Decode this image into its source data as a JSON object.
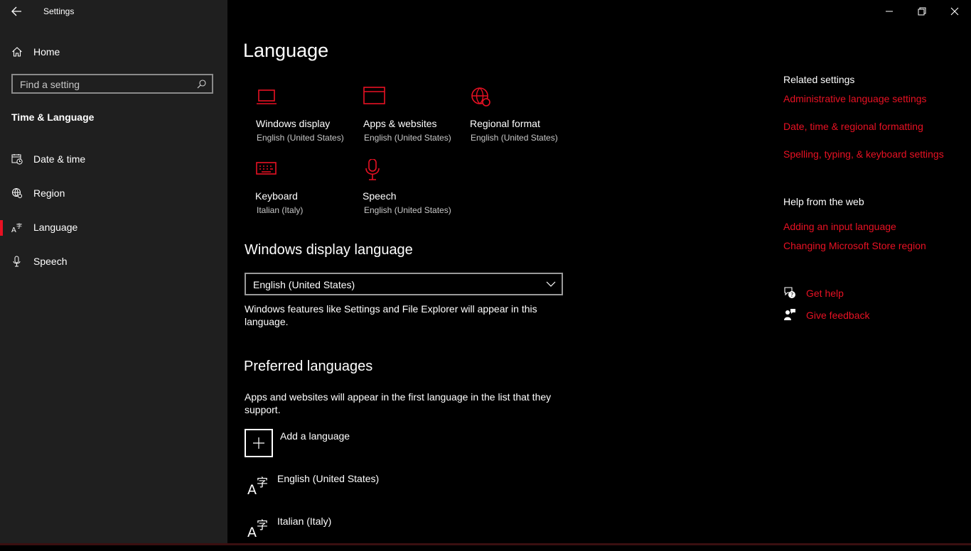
{
  "window": {
    "title": "Settings"
  },
  "sidebar": {
    "home_label": "Home",
    "search_placeholder": "Find a setting",
    "section_title": "Time & Language",
    "items": [
      {
        "label": "Date & time",
        "icon": "calendar-clock-icon"
      },
      {
        "label": "Region",
        "icon": "globe-icon"
      },
      {
        "label": "Language",
        "icon": "language-icon",
        "active": true
      },
      {
        "label": "Speech",
        "icon": "microphone-icon"
      }
    ]
  },
  "main": {
    "title": "Language",
    "tiles": [
      {
        "label": "Windows display",
        "value": "English (United States)",
        "icon": "laptop-icon"
      },
      {
        "label": "Apps & websites",
        "value": "English (United States)",
        "icon": "browser-window-icon"
      },
      {
        "label": "Regional format",
        "value": "English (United States)",
        "icon": "globe-settings-icon"
      },
      {
        "label": "Keyboard",
        "value": "Italian (Italy)",
        "icon": "keyboard-icon"
      },
      {
        "label": "Speech",
        "value": "English (United States)",
        "icon": "microphone-icon"
      }
    ],
    "display_language": {
      "heading": "Windows display language",
      "selected": "English (United States)",
      "description": "Windows features like Settings and File Explorer will appear in this language."
    },
    "preferred": {
      "heading": "Preferred languages",
      "description": "Apps and websites will appear in the first language in the list that they support.",
      "add_label": "Add a language",
      "languages": [
        "English (United States)",
        "Italian (Italy)"
      ]
    }
  },
  "right": {
    "related_heading": "Related settings",
    "related_links": [
      "Administrative language settings",
      "Date, time & regional formatting",
      "Spelling, typing, & keyboard settings"
    ],
    "help_heading": "Help from the web",
    "help_links": [
      "Adding an input language",
      "Changing Microsoft Store region"
    ],
    "get_help": "Get help",
    "give_feedback": "Give feedback"
  },
  "colors": {
    "accent": "#e81123",
    "sidebar_bg": "#1f1f1f",
    "main_bg": "#000000"
  }
}
